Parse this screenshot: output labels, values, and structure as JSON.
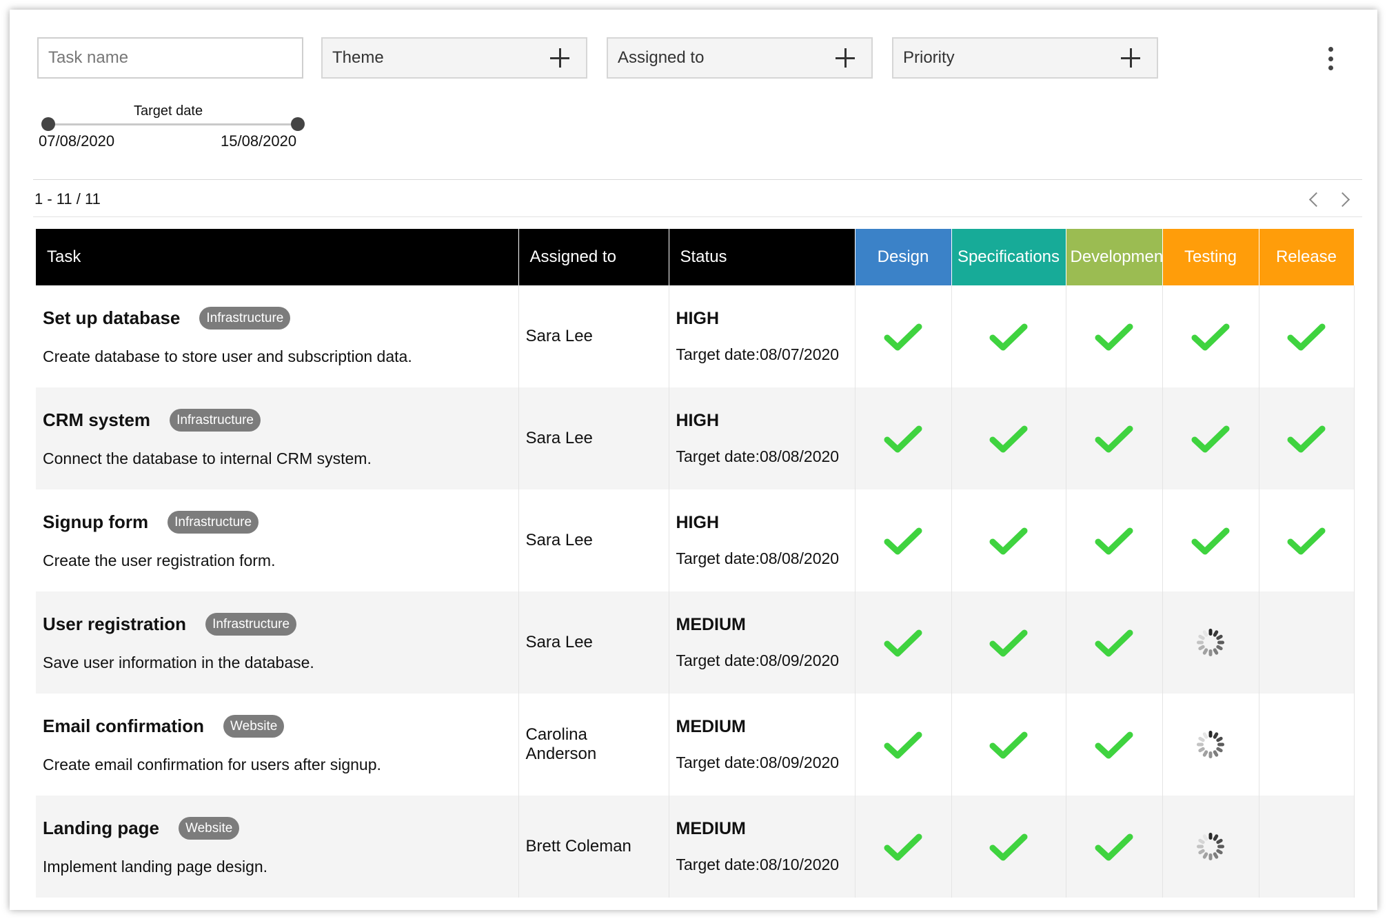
{
  "filters": {
    "task_name_placeholder": "Task name",
    "theme_label": "Theme",
    "assigned_label": "Assigned to",
    "priority_label": "Priority"
  },
  "date_slider": {
    "title": "Target date",
    "start": "07/08/2020",
    "end": "15/08/2020"
  },
  "pagination": {
    "range": "1 - 11 / 11"
  },
  "table": {
    "headers": {
      "task": "Task",
      "assigned": "Assigned to",
      "status": "Status",
      "stages": [
        "Design",
        "Specifications",
        "Development",
        "Testing",
        "Release"
      ]
    },
    "stage_colors": [
      "#3b82c8",
      "#17ab98",
      "#9bbc52",
      "#ff9d0a",
      "#ff9d0a"
    ],
    "rows": [
      {
        "title": "Set up database",
        "tag": "Infrastructure",
        "description": "Create database to store user and subscription data.",
        "assignee": "Sara Lee",
        "priority": "HIGH",
        "target": "Target date:08/07/2020",
        "stages": [
          "done",
          "done",
          "done",
          "done",
          "done"
        ]
      },
      {
        "title": "CRM system",
        "tag": "Infrastructure",
        "description": "Connect the database to internal CRM system.",
        "assignee": "Sara Lee",
        "priority": "HIGH",
        "target": "Target date:08/08/2020",
        "stages": [
          "done",
          "done",
          "done",
          "done",
          "done"
        ]
      },
      {
        "title": "Signup form",
        "tag": "Infrastructure",
        "description": "Create the user registration form.",
        "assignee": "Sara Lee",
        "priority": "HIGH",
        "target": "Target date:08/08/2020",
        "stages": [
          "done",
          "done",
          "done",
          "done",
          "done"
        ]
      },
      {
        "title": "User registration",
        "tag": "Infrastructure",
        "description": "Save user information in the database.",
        "assignee": "Sara Lee",
        "priority": "MEDIUM",
        "target": "Target date:08/09/2020",
        "stages": [
          "done",
          "done",
          "done",
          "in-progress",
          "none"
        ]
      },
      {
        "title": "Email confirmation",
        "tag": "Website",
        "description": "Create email confirmation for users after signup.",
        "assignee": "Carolina Anderson",
        "priority": "MEDIUM",
        "target": "Target date:08/09/2020",
        "stages": [
          "done",
          "done",
          "done",
          "in-progress",
          "none"
        ]
      },
      {
        "title": "Landing page",
        "tag": "Website",
        "description": "Implement landing page design.",
        "assignee": "Brett Coleman",
        "priority": "MEDIUM",
        "target": "Target date:08/10/2020",
        "stages": [
          "done",
          "done",
          "done",
          "in-progress",
          "none"
        ]
      }
    ]
  }
}
